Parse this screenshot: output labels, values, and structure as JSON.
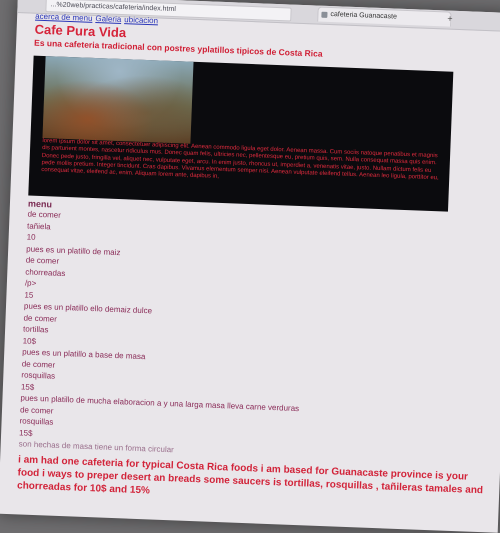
{
  "browser": {
    "url": "...%20web/practicas/cafeteria/index.html",
    "tab_title": "cafeteria Guanacaste",
    "new_tab_glyph": "+"
  },
  "nav": {
    "links": [
      "acerca de menu",
      "Galeria",
      "ubicacion"
    ]
  },
  "site": {
    "title": "Cafe Pura Vida",
    "subtitle": "Es una cafeteria tradicional con postres yplatillos tipicos de Costa Rica"
  },
  "hero": {
    "image_alt": "painting of a colonial town scene",
    "lorem": "lorem ipsum dolor sit amet, consectetuer adipiscing elit. Aenean commodo ligula eget dolor. Aenean massa. Cum sociis natoque penatibus et magnis dis parturient montes, nascetur ridiculus mus. Donec quam felis, ultricies nec, pellentesque eu, pretium quis, sem. Nulla consequat massa quis enim. Donec pede justo, fringilla vel, aliquet nec, vulputate eget, arcu. In enim justo, rhoncus ut, imperdiet a, venenatis vitae, justo. Nullam dictum felis eu pede mollis pretium. Integer tincidunt. Cras dapibus. Vivamus elementum semper nisi. Aenean vulputate eleifend tellus. Aenean leo ligula, porttitor eu, consequat vitae, eleifend ac, enim. Aliquam lorem ante, dapibus in,"
  },
  "menu": {
    "heading": "menu",
    "lines": [
      "de comer",
      "tañiela",
      "10",
      "pues es un platillo de maiz",
      "de comer",
      "chorreadas",
      "/p>",
      "15",
      "pues es un platillo ello demaiz dulce",
      "de comer",
      "tortillas",
      "10$",
      "pues es un platillo a base de masa",
      "de comer",
      "rosquillas",
      "15$",
      "pues un platillo de mucha elaboracion a y una larga masa lleva carne verduras",
      "de comer",
      "rosquillas",
      "15$",
      "son hechas de masa tiene un forma circular"
    ]
  },
  "english_paragraph": "i am had one cafeteria for typical Costa Rica foods i am based for Guanacaste province is your food i ways to preper desert an breads some saucers is tortillas, rosquillas , tañileras tamales and chorreadas for 10$ and 15%"
}
